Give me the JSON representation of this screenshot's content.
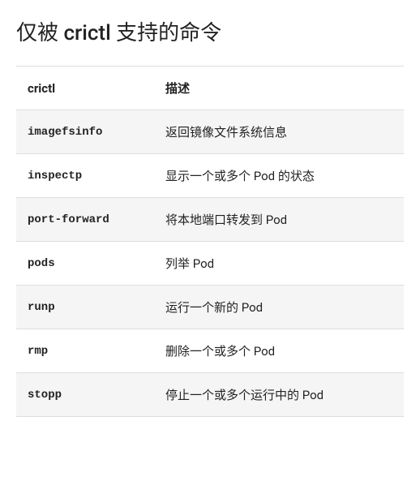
{
  "heading": "仅被 crictl 支持的命令",
  "table": {
    "headers": {
      "col1": "crictl",
      "col2": "描述"
    },
    "rows": [
      {
        "cmd": "imagefsinfo",
        "desc": "返回镜像文件系统信息"
      },
      {
        "cmd": "inspectp",
        "desc": "显示一个或多个 Pod 的状态"
      },
      {
        "cmd": "port-forward",
        "desc": "将本地端口转发到 Pod"
      },
      {
        "cmd": "pods",
        "desc": "列举 Pod"
      },
      {
        "cmd": "runp",
        "desc": "运行一个新的 Pod"
      },
      {
        "cmd": "rmp",
        "desc": "删除一个或多个 Pod"
      },
      {
        "cmd": "stopp",
        "desc": "停止一个或多个运行中的 Pod"
      }
    ]
  }
}
